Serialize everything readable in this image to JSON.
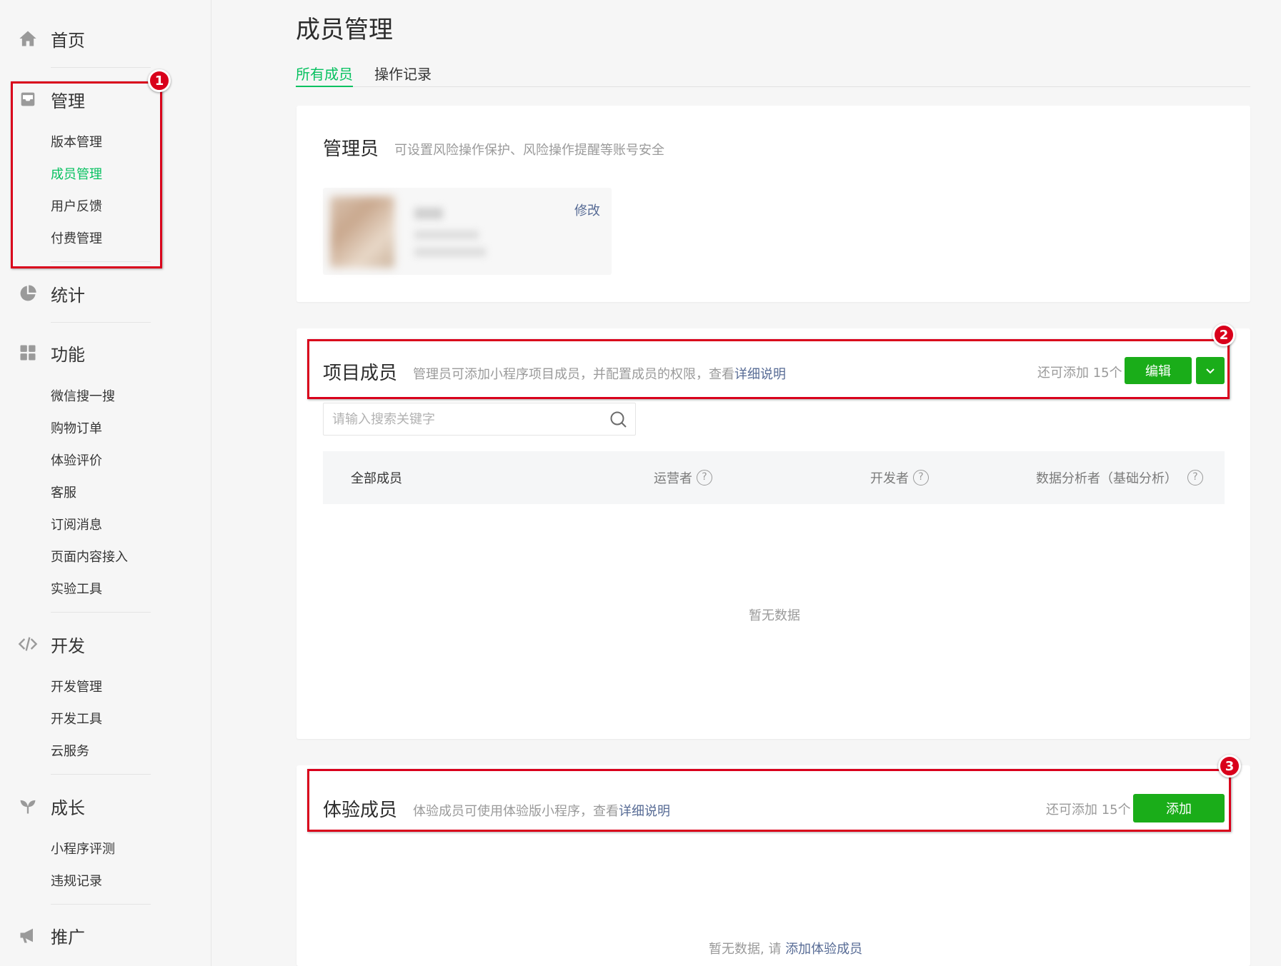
{
  "sidebar": {
    "home": {
      "label": "首页",
      "icon": "home-icon"
    },
    "manage": {
      "label": "管理",
      "icon": "inbox-icon",
      "items": [
        "版本管理",
        "成员管理",
        "用户反馈",
        "付费管理"
      ],
      "active_item": "成员管理"
    },
    "stats": {
      "label": "统计",
      "icon": "pie-chart-icon"
    },
    "features": {
      "label": "功能",
      "icon": "grid-icon",
      "items": [
        "微信搜一搜",
        "购物订单",
        "体验评价",
        "客服",
        "订阅消息",
        "页面内容接入",
        "实验工具"
      ]
    },
    "dev": {
      "label": "开发",
      "icon": "code-icon",
      "items": [
        "开发管理",
        "开发工具",
        "云服务"
      ]
    },
    "growth": {
      "label": "成长",
      "icon": "sprout-icon",
      "items": [
        "小程序评测",
        "违规记录"
      ]
    },
    "promo": {
      "label": "推广",
      "icon": "megaphone-icon"
    }
  },
  "page": {
    "title": "成员管理",
    "tabs": [
      "所有成员",
      "操作记录"
    ],
    "active_tab": "所有成员"
  },
  "admin_card": {
    "title": "管理员",
    "desc": "可设置风险操作保护、风险操作提醒等账号安全",
    "edit_label": "修改"
  },
  "project_card": {
    "title": "项目成员",
    "desc": "管理员可添加小程序项目成员，并配置成员的权限，查看",
    "desc_link": "详细说明",
    "quota": "还可添加 15个",
    "edit_button": "编辑",
    "search_placeholder": "请输入搜索关键字",
    "columns": [
      "全部成员",
      "运营者",
      "开发者",
      "数据分析者（基础分析）"
    ],
    "help_mark": "?",
    "empty": "暂无数据"
  },
  "trial_card": {
    "title": "体验成员",
    "desc": "体验成员可使用体验版小程序，查看",
    "desc_link": "详细说明",
    "quota": "还可添加 15个",
    "add_button": "添加",
    "empty_prefix": "暂无数据, 请",
    "empty_link": "添加体验成员"
  },
  "annotations": [
    "1",
    "2",
    "3"
  ],
  "colors": {
    "accent_green": "#07c160",
    "button_green": "#1aad19",
    "link_blue": "#576b95",
    "annotation_red": "#d9001b"
  }
}
